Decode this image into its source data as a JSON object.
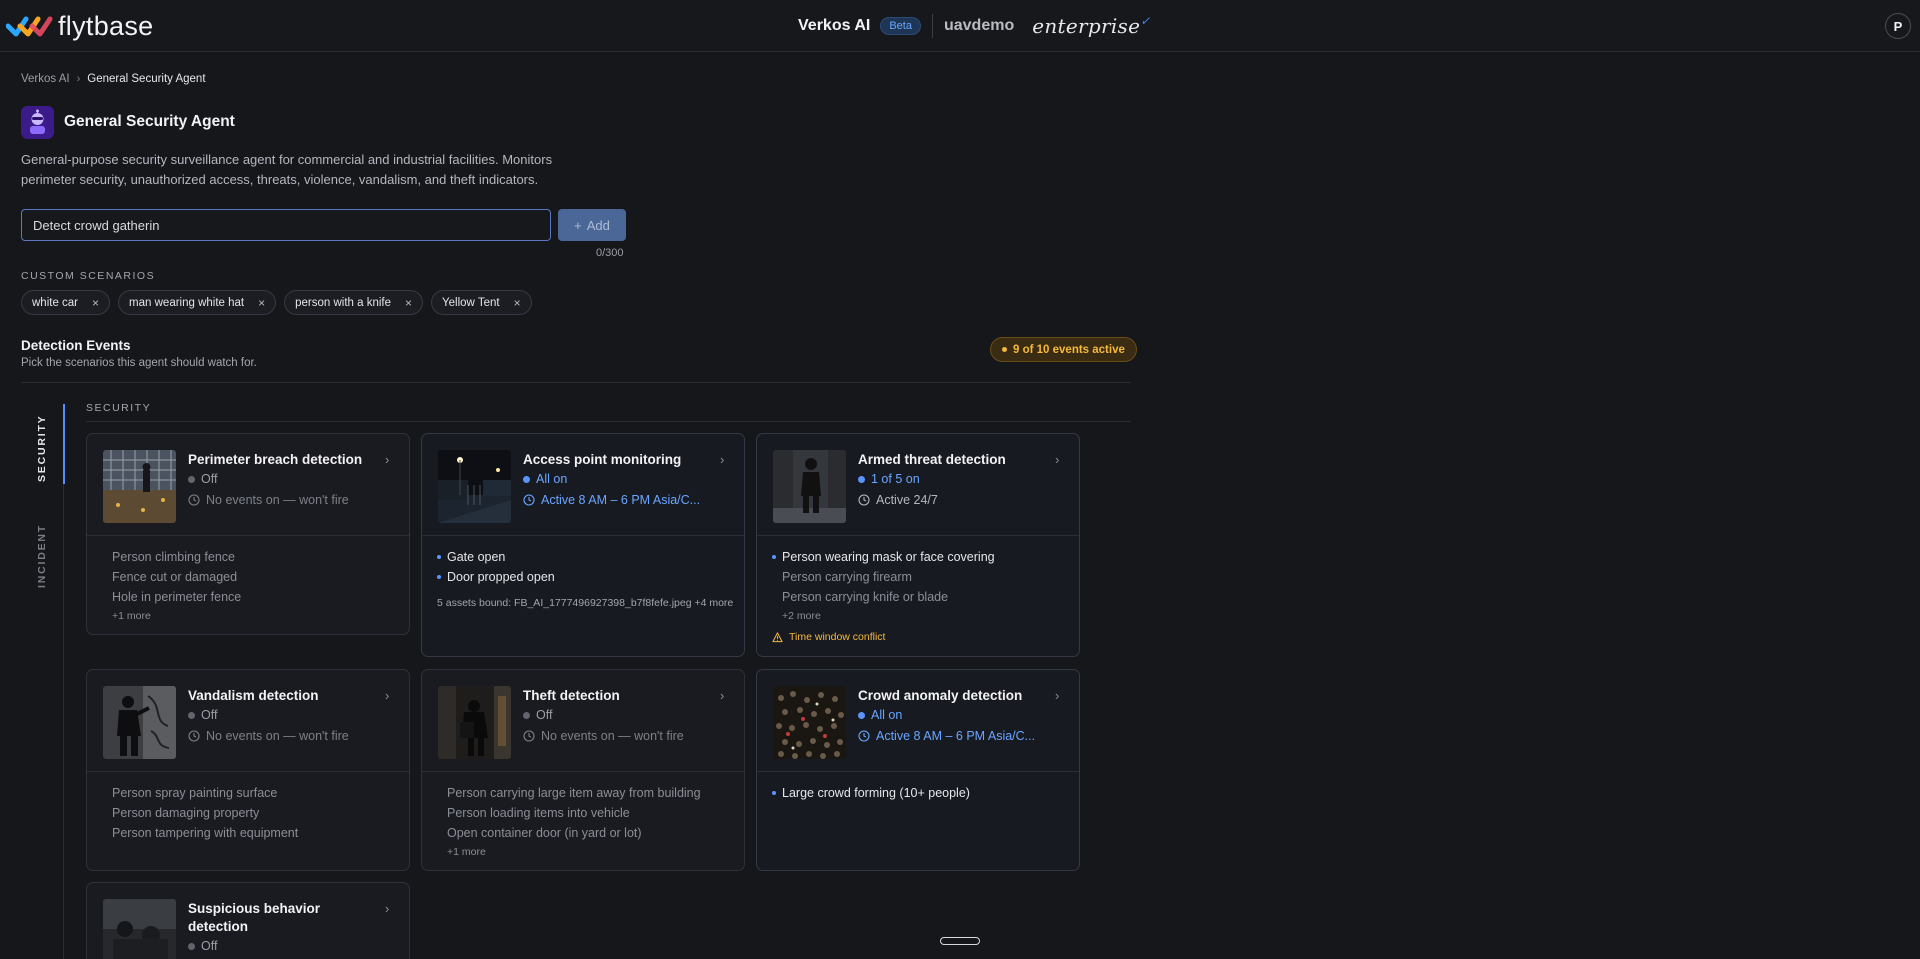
{
  "topbar": {
    "logo_text": "flytbase",
    "app_name": "Verkos AI",
    "beta_label": "Beta",
    "org_name": "uavdemo",
    "plan_name": "enterprise",
    "avatar_initial": "P"
  },
  "breadcrumb": {
    "parent": "Verkos AI",
    "current": "General Security Agent"
  },
  "agent": {
    "title": "General Security Agent",
    "description": "General-purpose security surveillance agent for commercial and industrial facilities. Monitors perimeter security, unauthorized access, threats, violence, vandalism, and theft indicators."
  },
  "scenario_input": {
    "value": "Detect crowd gatherin",
    "add_label": "Add",
    "char_count": "0/300"
  },
  "custom_scenarios": {
    "label": "CUSTOM SCENARIOS",
    "chips": [
      "white car",
      "man wearing white hat",
      "person with a knife",
      "Yellow Tent"
    ]
  },
  "detection_events": {
    "title": "Detection Events",
    "subtitle": "Pick the scenarios this agent should watch for.",
    "active_badge": "9 of 10 events active"
  },
  "side_tabs": [
    "SECURITY",
    "INCIDENT"
  ],
  "section_label": "SECURITY",
  "cards": [
    {
      "title": "Perimeter breach detection",
      "status": "Off",
      "schedule": "No events on — won't fire",
      "items": [
        "Person climbing fence",
        "Fence cut or damaged",
        "Hole in perimeter fence"
      ],
      "more": "+1 more"
    },
    {
      "title": "Access point monitoring",
      "status": "All on",
      "schedule": "Active 8 AM – 6 PM Asia/C...",
      "items": [
        "Gate open",
        "Door propped open"
      ],
      "assets": "5 assets bound: FB_AI_1777496927398_b7f8fefe.jpeg +4 more"
    },
    {
      "title": "Armed threat detection",
      "status": "1 of 5 on",
      "schedule": "Active 24/7",
      "items": [
        "Person wearing mask or face covering",
        "Person carrying firearm",
        "Person carrying knife or blade"
      ],
      "more": "+2 more",
      "warning": "Time window conflict"
    },
    {
      "title": "Vandalism detection",
      "status": "Off",
      "schedule": "No events on — won't fire",
      "items": [
        "Person spray painting surface",
        "Person damaging property",
        "Person tampering with equipment"
      ]
    },
    {
      "title": "Theft detection",
      "status": "Off",
      "schedule": "No events on — won't fire",
      "items": [
        "Person carrying large item away from building",
        "Person loading items into vehicle",
        "Open container door (in yard or lot)"
      ],
      "more": "+1 more"
    },
    {
      "title": "Crowd anomaly detection",
      "status": "All on",
      "schedule": "Active 8 AM – 6 PM Asia/C...",
      "items": [
        "Large crowd forming (10+ people)"
      ]
    },
    {
      "title": "Suspicious behavior detection",
      "status": "Off"
    }
  ],
  "colors": {
    "accent_blue": "#5a95ff",
    "warning_amber": "#f5b83d",
    "background": "#16171b"
  },
  "icons": [
    "flytbase-logo-icon",
    "chevron-right-icon",
    "close-icon",
    "plus-icon",
    "clock-icon",
    "warning-icon",
    "agent-robot-icon"
  ]
}
